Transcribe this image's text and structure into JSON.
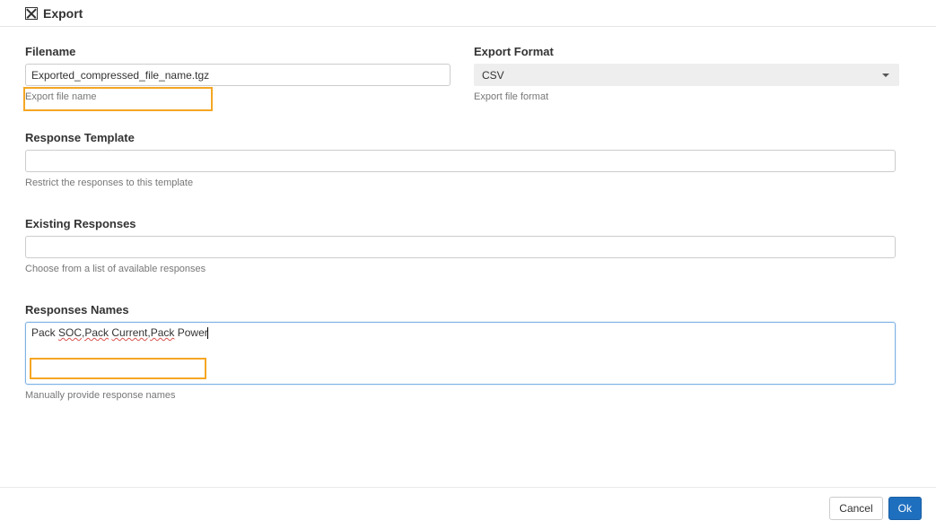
{
  "header": {
    "title": "Export"
  },
  "filename": {
    "label": "Filename",
    "value": "Exported_compressed_file_name.tgz",
    "helper": "Export file name"
  },
  "format": {
    "label": "Export Format",
    "value": "CSV",
    "helper": "Export file format"
  },
  "template": {
    "label": "Response Template",
    "value": "",
    "helper": "Restrict the responses to this template"
  },
  "existing": {
    "label": "Existing Responses",
    "value": "",
    "helper": "Choose from a list of available responses"
  },
  "names": {
    "label": "Responses Names",
    "segments": [
      {
        "text": "Pack ",
        "spell": false
      },
      {
        "text": "SOC,Pack",
        "spell": true
      },
      {
        "text": " ",
        "spell": false
      },
      {
        "text": "Current,Pack",
        "spell": true
      },
      {
        "text": " Power",
        "spell": false
      }
    ],
    "helper": "Manually provide response names"
  },
  "footer": {
    "cancel": "Cancel",
    "ok": "Ok"
  }
}
